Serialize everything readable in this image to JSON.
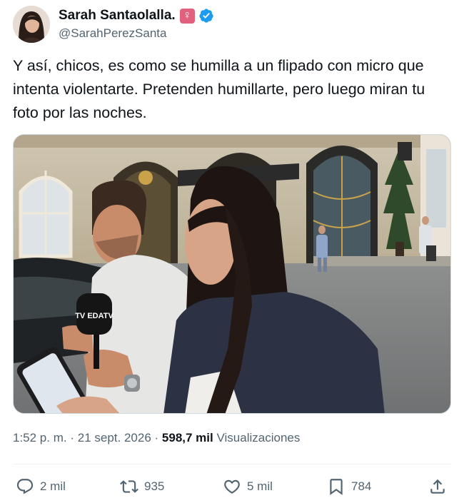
{
  "author": {
    "display_name": "Sarah Santaolalla.",
    "handle": "@SarahPerezSanta",
    "emoji": "♀",
    "verified": true,
    "accent_color": "#1d9bf0"
  },
  "tweet": {
    "text": "Y así, chicos, es como se humilla a un flipado con micro que\nintenta violentarte. Pretenden humillarte, pero luego miran tu\nfoto por las noches.",
    "microphone_text": "TV EDATV"
  },
  "meta": {
    "time": "1:52 p. m.",
    "separator": "·",
    "date": "21 sept. 2026",
    "views_count": "598,7 mil",
    "views_label": "Visualizaciones"
  },
  "actions": {
    "replies": "2 mil",
    "reposts": "935",
    "likes": "5 mil",
    "bookmarks": "784"
  }
}
